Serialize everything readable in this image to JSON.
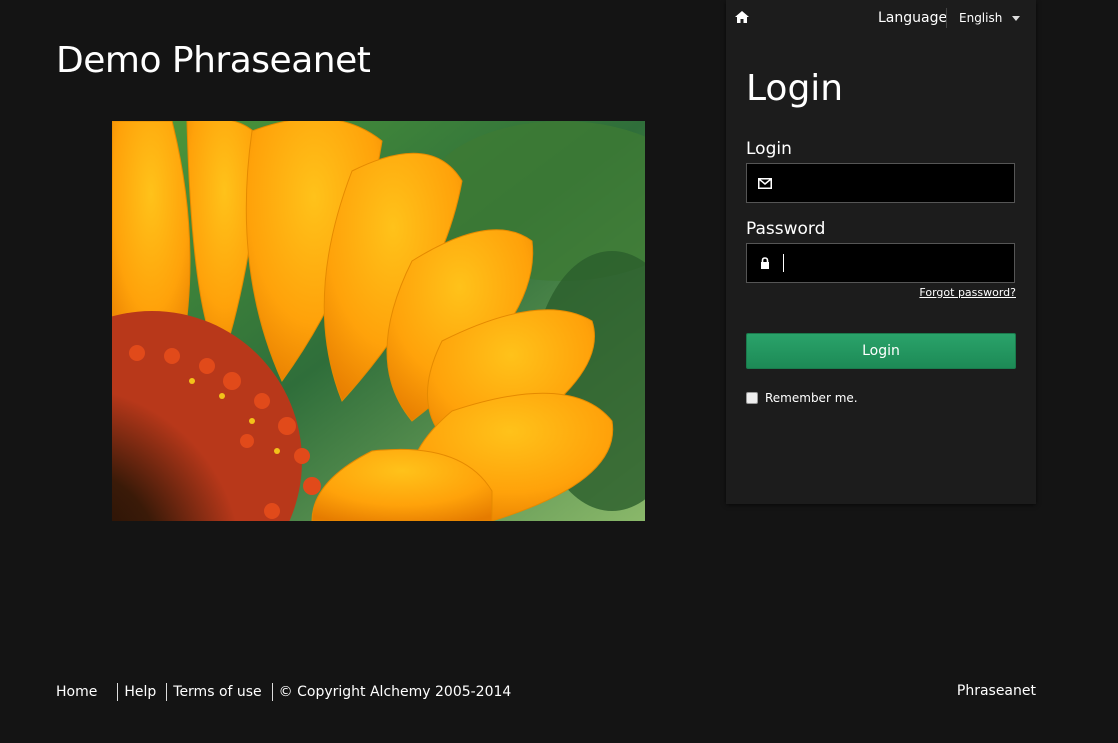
{
  "app": {
    "title": "Demo Phraseanet"
  },
  "hero": {
    "image": "sunflower-photo"
  },
  "topbar": {
    "home_icon": "home-icon",
    "language_label": "Language",
    "language_selected": "English"
  },
  "login_form": {
    "heading": "Login",
    "login_label": "Login",
    "login_value": "",
    "login_icon": "envelope-icon",
    "password_label": "Password",
    "password_value": "",
    "password_icon": "lock-icon",
    "forgot_password": "Forgot password?",
    "submit_label": "Login",
    "remember_label": "Remember me.",
    "remember_checked": false
  },
  "footer": {
    "links": [
      "Home",
      "Help",
      "Terms of use"
    ],
    "copyright": "© Copyright Alchemy 2005-2014",
    "brand": "Phraseanet"
  },
  "colors": {
    "background": "#141414",
    "panel": "#1c1c1c",
    "accent_green": "#1d8a56"
  }
}
